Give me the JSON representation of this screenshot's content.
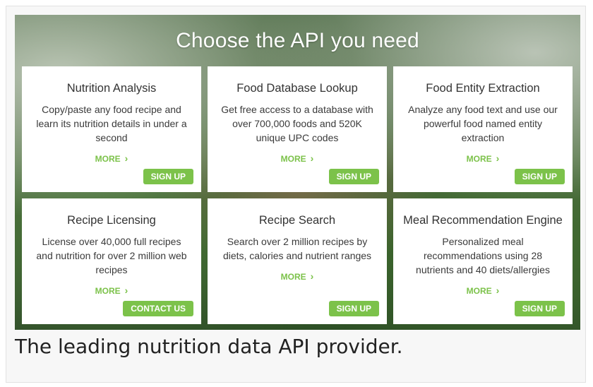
{
  "hero": {
    "title": "Choose the API you need"
  },
  "cards": [
    {
      "title": "Nutrition Analysis",
      "description": "Copy/paste any food recipe and learn its nutrition details in under a second",
      "more_label": "MORE",
      "button_label": "SIGN UP"
    },
    {
      "title": "Food Database Lookup",
      "description": "Get free access to a database with over 700,000 foods and 520K unique UPC codes",
      "more_label": "MORE",
      "button_label": "SIGN UP"
    },
    {
      "title": "Food Entity Extraction",
      "description": "Analyze any food text and use our powerful food named entity extraction",
      "more_label": "MORE",
      "button_label": "SIGN UP"
    },
    {
      "title": "Recipe Licensing",
      "description": "License over 40,000 full recipes and nutrition for over 2 million web recipes",
      "more_label": "MORE",
      "button_label": "CONTACT US"
    },
    {
      "title": "Recipe Search",
      "description": "Search over 2 million recipes by diets, calories and nutrient ranges",
      "more_label": "MORE",
      "button_label": "SIGN UP"
    },
    {
      "title": "Meal Recommendation Engine",
      "description": "Personalized meal recommendations using 28 nutrients and 40 diets/allergies",
      "more_label": "MORE",
      "button_label": "SIGN UP"
    }
  ],
  "tagline": "The leading nutrition data API provider.",
  "colors": {
    "accent": "#7cc24a"
  }
}
